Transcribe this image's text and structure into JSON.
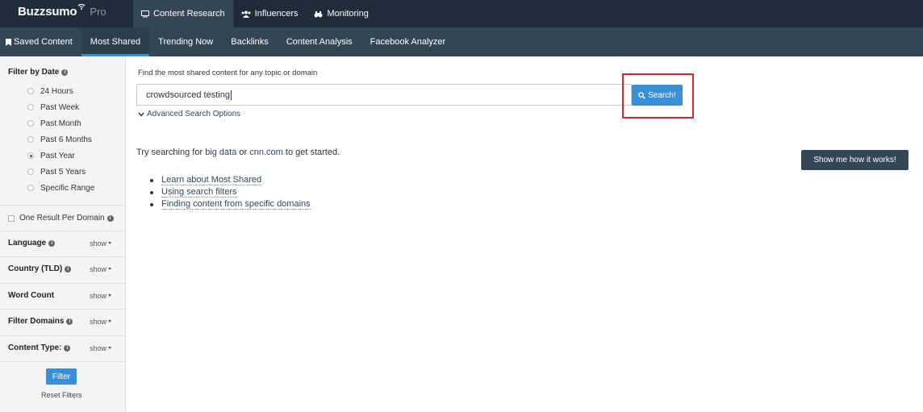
{
  "topbar": {
    "logo_name": "Buzzsumo",
    "logo_pro": "Pro",
    "nav": [
      {
        "label": "Content Research",
        "icon": "monitor-icon",
        "active": true
      },
      {
        "label": "Influencers",
        "icon": "users-icon",
        "active": false
      },
      {
        "label": "Monitoring",
        "icon": "binoculars-icon",
        "active": false
      }
    ]
  },
  "subnav": {
    "items": [
      {
        "label": "Saved Content",
        "icon": "bookmark-icon",
        "active": false
      },
      {
        "label": "Most Shared",
        "active": true
      },
      {
        "label": "Trending Now",
        "active": false
      },
      {
        "label": "Backlinks",
        "active": false
      },
      {
        "label": "Content Analysis",
        "active": false
      },
      {
        "label": "Facebook Analyzer",
        "active": false
      }
    ]
  },
  "sidebar": {
    "date_title": "Filter by Date",
    "date_options": [
      {
        "label": "24 Hours",
        "checked": false
      },
      {
        "label": "Past Week",
        "checked": false
      },
      {
        "label": "Past Month",
        "checked": false
      },
      {
        "label": "Past 6 Months",
        "checked": false
      },
      {
        "label": "Past Year",
        "checked": true
      },
      {
        "label": "Past 5 Years",
        "checked": false
      },
      {
        "label": "Specific Range",
        "checked": false
      }
    ],
    "one_result_label": "One Result Per Domain",
    "filters": [
      {
        "label": "Language",
        "show": "show"
      },
      {
        "label": "Country (TLD)",
        "show": "show"
      },
      {
        "label": "Word Count",
        "show": "show"
      },
      {
        "label": "Filter Domains",
        "show": "show"
      },
      {
        "label": "Content Type:",
        "show": "show"
      }
    ],
    "filter_button": "Filter",
    "reset_label": "Reset Filters"
  },
  "main": {
    "search_label": "Find the most shared content for any topic or domain",
    "search_value": "crowdsourced testing",
    "search_button": "Search!",
    "advanced_label": "Advanced Search Options",
    "try_prefix": "Try searching for",
    "try_link1": "big data",
    "try_or": "or",
    "try_link2": "cnn.com",
    "try_suffix": "to get started.",
    "show_how_button": "Show me how it works!",
    "help_links": [
      "Learn about Most Shared",
      "Using search filters",
      "Finding content from specific domains"
    ]
  },
  "colors": {
    "topbar": "#1f2d3a",
    "subnav": "#344656",
    "accent": "#3a8fd9",
    "highlight": "#d9262c"
  }
}
